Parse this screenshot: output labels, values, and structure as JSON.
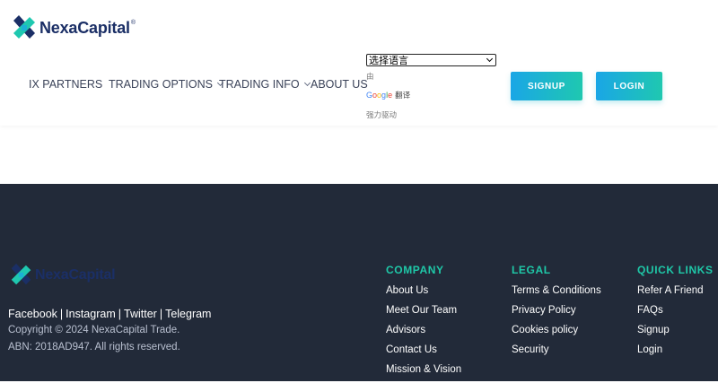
{
  "header": {
    "logo_text": "NexaCapital",
    "logo_reg": "®",
    "nav": [
      {
        "label": "IX PARTNERS",
        "has_dropdown": false
      },
      {
        "label": "TRADING OPTIONS",
        "has_dropdown": true
      },
      {
        "label": "TRADING INFO",
        "has_dropdown": true
      },
      {
        "label": "ABOUT US",
        "has_dropdown": false
      }
    ],
    "translate": {
      "select_value": "选择语言",
      "by": "由",
      "google": [
        "G",
        "o",
        "o",
        "g",
        "l",
        "e"
      ],
      "google_colors": [
        "#4285F4",
        "#EA4335",
        "#FBBC05",
        "#4285F4",
        "#34A853",
        "#EA4335"
      ],
      "translate_word": "翻译",
      "powered": "强力驱动"
    },
    "signup_label": "SIGNUP",
    "login_label": "LOGIN"
  },
  "footer": {
    "logo_text": "NexaCapital",
    "social": [
      "Facebook",
      "Instagram",
      "Twitter",
      "Telegram"
    ],
    "copyright": "Copyright © 2024 NexaCapital Trade.",
    "abn": "ABN: 2018AD947. All rights reserved.",
    "columns": [
      {
        "title": "COMPANY",
        "links": [
          "About Us",
          "Meet Our Team",
          "Advisors",
          "Contact Us",
          "Mission & Vision"
        ]
      },
      {
        "title": "LEGAL",
        "links": [
          "Terms & Conditions",
          "Privacy Policy",
          "Cookies policy",
          "Security"
        ]
      },
      {
        "title": "QUICK LINKS",
        "links": [
          "Refer A Friend",
          "FAQs",
          "Signup",
          "Login"
        ]
      }
    ]
  },
  "colors": {
    "accent_teal": "#1fc8a8",
    "button_gradient_start": "#1aa6e6",
    "button_gradient_end": "#1fc8b0",
    "footer_bg": "#222a39",
    "brand_navy": "#1b2f66"
  }
}
